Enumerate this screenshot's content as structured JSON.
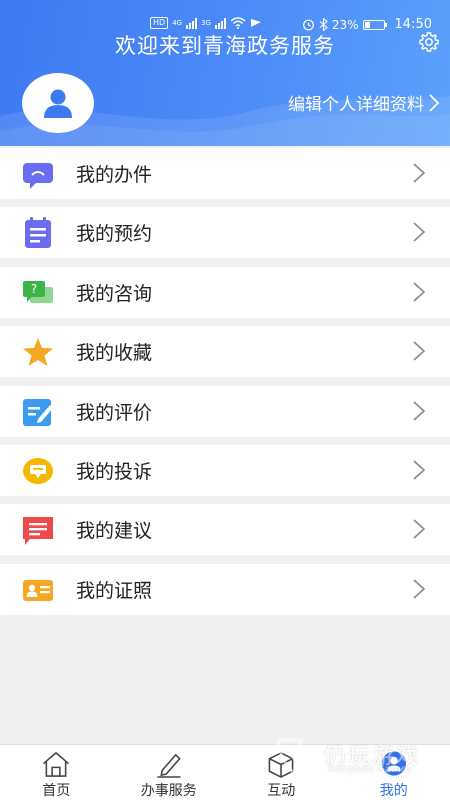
{
  "status_bar": {
    "left_chips": [
      "HD",
      "4G",
      "3G"
    ],
    "battery": "23%",
    "time": "14:50"
  },
  "header": {
    "title": "欢迎来到青海政务服务",
    "edit_profile": "编辑个人详细资料"
  },
  "menu": [
    {
      "label": "我的办件",
      "icon": "chat-bubble-icon",
      "color": "#6a6df0"
    },
    {
      "label": "我的预约",
      "icon": "calendar-note-icon",
      "color": "#6a6df0"
    },
    {
      "label": "我的咨询",
      "icon": "question-chat-icon",
      "color": "#3cb44a"
    },
    {
      "label": "我的收藏",
      "icon": "star-icon",
      "color": "#f5a623"
    },
    {
      "label": "我的评价",
      "icon": "edit-note-icon",
      "color": "#3a9bf0"
    },
    {
      "label": "我的投诉",
      "icon": "complaint-bubble-icon",
      "color": "#f5b800"
    },
    {
      "label": "我的建议",
      "icon": "suggestion-note-icon",
      "color": "#ef4a4a"
    },
    {
      "label": "我的证照",
      "icon": "id-card-icon",
      "color": "#f5a623"
    }
  ],
  "tabs": [
    {
      "label": "首页",
      "icon": "home-icon",
      "active": false
    },
    {
      "label": "办事服务",
      "icon": "pen-icon",
      "active": false
    },
    {
      "label": "互动",
      "icon": "cube-icon",
      "active": false
    },
    {
      "label": "我的",
      "icon": "person-icon",
      "active": true
    }
  ],
  "watermark": {
    "main": "仍玩游戏",
    "sub": "Rengwan Games"
  },
  "colors": {
    "header_blue": "#4d8cf8",
    "tab_active": "#2f6fe8"
  }
}
